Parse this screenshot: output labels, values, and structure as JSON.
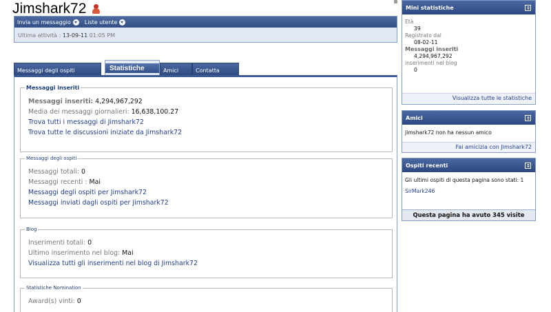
{
  "header": {
    "username": "Jimshark72",
    "menu": {
      "send_message": "Invia un messaggio",
      "user_lists": "Liste utente"
    },
    "activity_label": "Ultima attività :",
    "activity_date": "13-09-11",
    "activity_time": "01:05 PM"
  },
  "tabs": [
    {
      "label": "Messaggi degli ospiti"
    },
    {
      "label": "Statistiche"
    },
    {
      "label": "Amici"
    },
    {
      "label": "Contatta"
    }
  ],
  "sections": {
    "posts": {
      "legend": "Messaggi inseriti",
      "total_label": "Messaggi inseriti:",
      "total_value": "4,294,967,292",
      "avg_label": "Media dei messaggi giornalieri:",
      "avg_value": "16,638,100.27",
      "link_find_posts": "Trova tutti i messaggi di Jimshark72",
      "link_find_threads": "Trova tutte le discussioni iniziate da Jimshark72"
    },
    "guest": {
      "legend": "Messaggi degli ospiti",
      "total_label": "Messaggi totali:",
      "total_value": "0",
      "recent_label": "Messaggi recenti :",
      "recent_value": "Mai",
      "link_for": "Messaggi degli ospiti per Jimshark72",
      "link_sent": "Messaggi inviati dagli ospiti per Jimshark72"
    },
    "blog": {
      "legend": "Blog",
      "total_label": "Inserimenti totali:",
      "total_value": "0",
      "last_label": "Ultimo inserimento nel blog:",
      "last_value": "Mai",
      "link_all": "Visualizza tutti gli inserimenti nel blog di Jimshark72"
    },
    "nomination": {
      "legend": "Statistiche Nomination",
      "awards_label": "Award(s) vinti:",
      "awards_value": "0"
    }
  },
  "sidebar": {
    "mini_stats": {
      "title": "Mini statistiche",
      "age_label": "Età",
      "age_value": "39",
      "reg_label": "Registrato dal",
      "reg_value": "08-02-11",
      "posts_label": "Messaggi inseriti",
      "posts_value": "4,294,967,292",
      "blog_label": "inserimenti nel blog",
      "blog_value": "0",
      "view_all": "Visualizza tutte le statistiche"
    },
    "friends": {
      "title": "Amici",
      "text": "Jimshark72 non ha nessun amico",
      "action": "Fai amicizia con Jimshark72"
    },
    "recent_visitors": {
      "title": "Ospiti recenti",
      "text": "Gli ultimi ospiti di questa pagina sono stati: 1",
      "visitor": "SirMark246",
      "visits": "Questa pagina ha avuto 345 visite"
    }
  },
  "colors": {
    "header_bar": "#324f85",
    "link": "#1f3d8a",
    "panel_bg": "#e1e8f4",
    "border": "#7f9cc7"
  }
}
